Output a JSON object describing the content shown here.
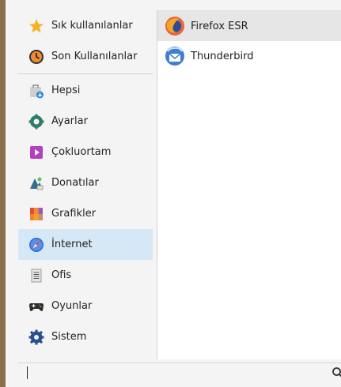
{
  "categories": [
    {
      "id": "favorites",
      "label": "Sık kullanılanlar",
      "icon": "star-icon"
    },
    {
      "id": "recent",
      "label": "Son Kullanılanlar",
      "icon": "clock-icon"
    },
    {
      "id": "all",
      "label": "Hepsi",
      "icon": "shopping-bag-icon"
    },
    {
      "id": "settings",
      "label": "Ayarlar",
      "icon": "gear-icon"
    },
    {
      "id": "multimedia",
      "label": "Çokluortam",
      "icon": "play-icon"
    },
    {
      "id": "accessories",
      "label": "Donatılar",
      "icon": "accessories-icon"
    },
    {
      "id": "graphics",
      "label": "Grafikler",
      "icon": "palette-icon"
    },
    {
      "id": "internet",
      "label": "İnternet",
      "icon": "compass-icon",
      "active": true
    },
    {
      "id": "office",
      "label": "Ofis",
      "icon": "document-icon"
    },
    {
      "id": "games",
      "label": "Oyunlar",
      "icon": "gamepad-icon"
    },
    {
      "id": "system",
      "label": "Sistem",
      "icon": "gear-icon"
    }
  ],
  "apps": [
    {
      "label": "Firefox ESR",
      "icon": "firefox-icon",
      "selected": true
    },
    {
      "label": "Thunderbird",
      "icon": "thunderbird-icon"
    }
  ],
  "search": {
    "value": "",
    "placeholder": ""
  },
  "colors": {
    "active_category": "#d6e8f5",
    "selected_app": "#e6e6e6",
    "background": "#f4f4f4"
  }
}
